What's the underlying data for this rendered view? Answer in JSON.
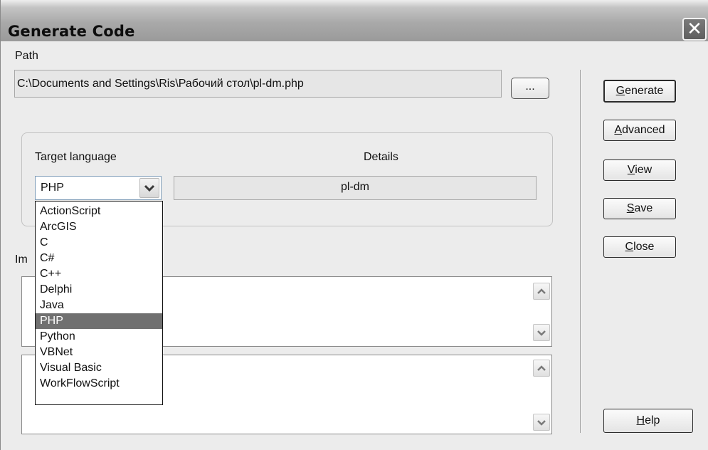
{
  "window": {
    "title": "Generate Code",
    "close_glyph": "✕"
  },
  "path": {
    "label": "Path",
    "value": "C:\\Documents and Settings\\Ris\\Рабочий стол\\pl-dm.php",
    "browse_label": "..."
  },
  "target": {
    "label": "Target language",
    "details_label": "Details",
    "details_value": "pl-dm",
    "selected": "PHP",
    "options": [
      "ActionScript",
      "ArcGIS",
      "C",
      "C#",
      "C++",
      "Delphi",
      "Java",
      "PHP",
      "Python",
      "VBNet",
      "Visual Basic",
      "WorkFlowScript"
    ]
  },
  "imports_label_partial": "Im",
  "buttons": {
    "generate": {
      "accel": "G",
      "rest": "enerate"
    },
    "advanced": {
      "accel": "A",
      "rest": "dvanced"
    },
    "view": {
      "accel": "V",
      "rest": "iew"
    },
    "save": {
      "accel": "S",
      "rest": "ave"
    },
    "close": {
      "accel": "C",
      "rest": "lose"
    },
    "help": {
      "accel": "H",
      "rest": "elp"
    }
  },
  "icons": {
    "dropdown": "chevron-down-icon",
    "scroll_up": "scroll-up-arrow-icon",
    "scroll_down": "scroll-down-arrow-icon"
  }
}
